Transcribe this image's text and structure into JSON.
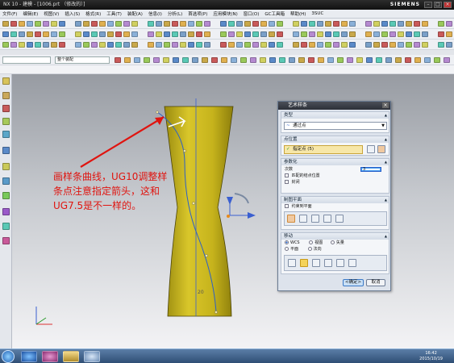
{
  "window": {
    "title": "NX 10 - 建模 - [1006.prt （修改的）]",
    "brand": "SIEMENS",
    "min": "–",
    "max": "□",
    "close": "×"
  },
  "menu": [
    "文件(F)",
    "编辑(E)",
    "视图(V)",
    "插入(S)",
    "格式(R)",
    "工具(T)",
    "装配(A)",
    "信息(I)",
    "分析(L)",
    "首选项(P)",
    "应用模块(N)",
    "窗口(O)",
    "GC工具箱",
    "帮助(H)",
    "3SUC"
  ],
  "selection": {
    "filter": "",
    "scope": "整个装配"
  },
  "annotation": "画样条曲线，UG10调整样条点注意指定箭头，这和UG7.5是不一样的。",
  "viewport": {
    "dim_label": "20",
    "body_color": "#c8b61e"
  },
  "dialog": {
    "title": "艺术样条",
    "type_header": "类型",
    "type_value": "通过点",
    "point_header": "点位置",
    "point_value": "指定点 (5)",
    "param_header": "参数化",
    "degree_label": "次数",
    "degree_value": "3",
    "match_knot": "匹配的结点位置",
    "closed": "封闭",
    "plane_header": "制图平面",
    "constrain_plane": "约束到平面",
    "move_header": "移动",
    "move_opts": [
      "WCS",
      "视图",
      "矢量",
      "平面",
      "法向"
    ],
    "ok": "<确定>",
    "cancel": "取消"
  },
  "clock": {
    "time": "16:42",
    "date": "2015/10/19"
  }
}
